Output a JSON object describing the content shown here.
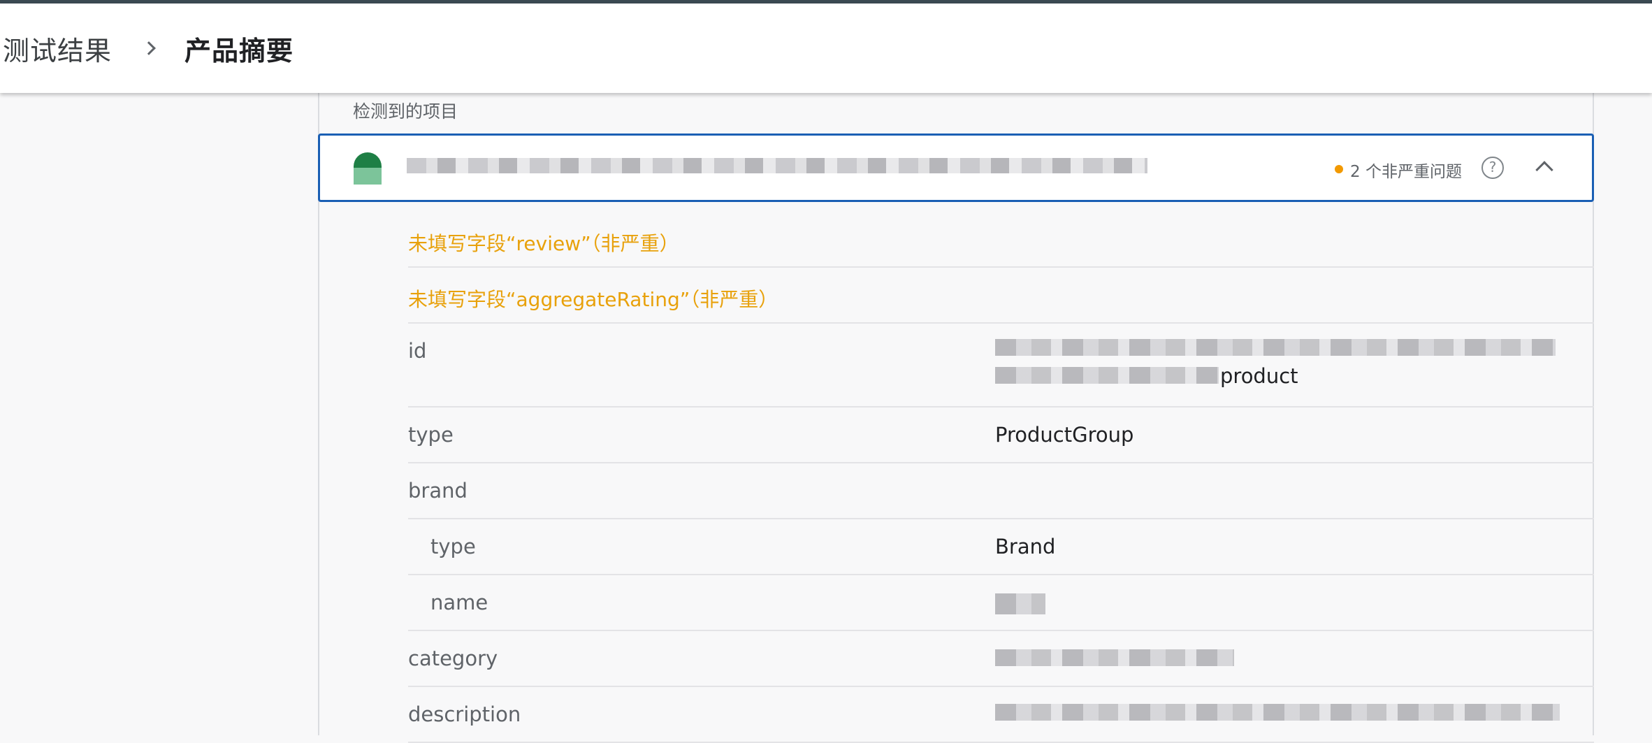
{
  "breadcrumb": {
    "parent": "测试结果",
    "current": "产品摘要"
  },
  "section_label": "检测到的项目",
  "item": {
    "issue_count_text": "2 个非严重问题",
    "help_glyph": "?",
    "colors": {
      "accent": "#1a5fb4",
      "warning": "#e8a10b",
      "dot": "#f29900",
      "icon_dark": "#1e7f45",
      "icon_light": "#7cc49a"
    }
  },
  "warnings": [
    "未填写字段“review”（非严重）",
    "未填写字段“aggregateRating”（非严重）"
  ],
  "properties": [
    {
      "key": "id",
      "value": "product"
    },
    {
      "key": "type",
      "value": "ProductGroup"
    },
    {
      "key": "brand",
      "value": ""
    },
    {
      "key": "type",
      "value": "Brand"
    },
    {
      "key": "name",
      "value": ""
    },
    {
      "key": "category",
      "value": ""
    },
    {
      "key": "description",
      "value": ""
    }
  ]
}
